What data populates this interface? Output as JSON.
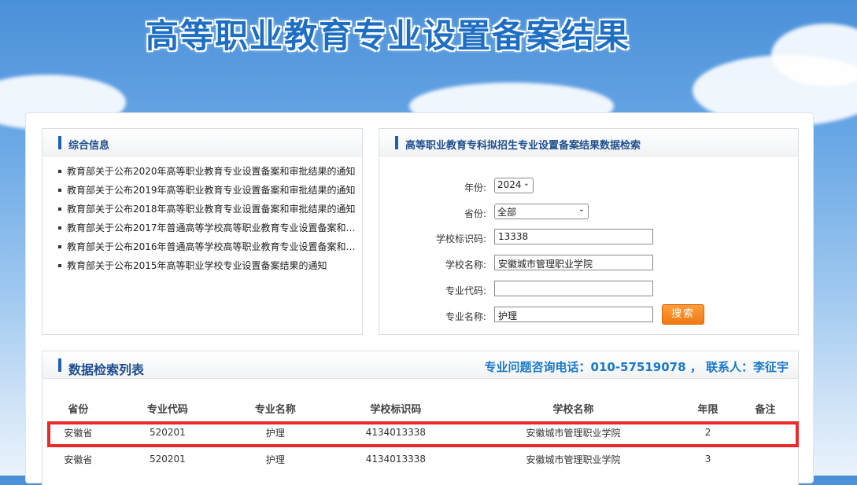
{
  "header": {
    "title": "高等职业教育专业设置备案结果"
  },
  "news_panel": {
    "title": "综合信息",
    "items": [
      "教育部关于公布2020年高等职业教育专业设置备案和审批结果的通知",
      "教育部关于公布2019年高等职业教育专业设置备案和审批结果的通知",
      "教育部关于公布2018年高等职业教育专业设置备案和审批结果的通知",
      "教育部关于公布2017年普通高等学校高等职业教育专业设置备案和审...",
      "教育部关于公布2016年普通高等学校高等职业教育专业设置备案和审...",
      "教育部关于公布2015年高等职业学校专业设置备案结果的通知"
    ]
  },
  "search_panel": {
    "title": "高等职业教育专科拟招生专业设置备案结果数据检索",
    "year_label": "年份:",
    "year_value": "2024",
    "province_label": "省份:",
    "province_value": "全部",
    "school_code_label": "学校标识码:",
    "school_code_value": "13338",
    "school_name_label": "学校名称:",
    "school_name_value": "安徽城市管理职业学院",
    "major_code_label": "专业代码:",
    "major_code_value": "",
    "major_name_label": "专业名称:",
    "major_name_value": "护理",
    "search_button": "搜索"
  },
  "results": {
    "title": "数据检索列表",
    "hotline": "专业问题咨询电话：010-57519078 ， 联系人：李征宇",
    "columns": [
      "省份",
      "专业代码",
      "专业名称",
      "学校标识码",
      "学校名称",
      "年限",
      "备注"
    ],
    "rows": [
      [
        "安徽省",
        "520201",
        "护理",
        "4134013338",
        "安徽城市管理职业学院",
        "2",
        ""
      ],
      [
        "安徽省",
        "520201",
        "护理",
        "4134013338",
        "安徽城市管理职业学院",
        "3",
        ""
      ]
    ]
  },
  "colors": {
    "accent": "#1f5fb8",
    "button": "#f07a12",
    "highlight": "#e82a2a"
  }
}
